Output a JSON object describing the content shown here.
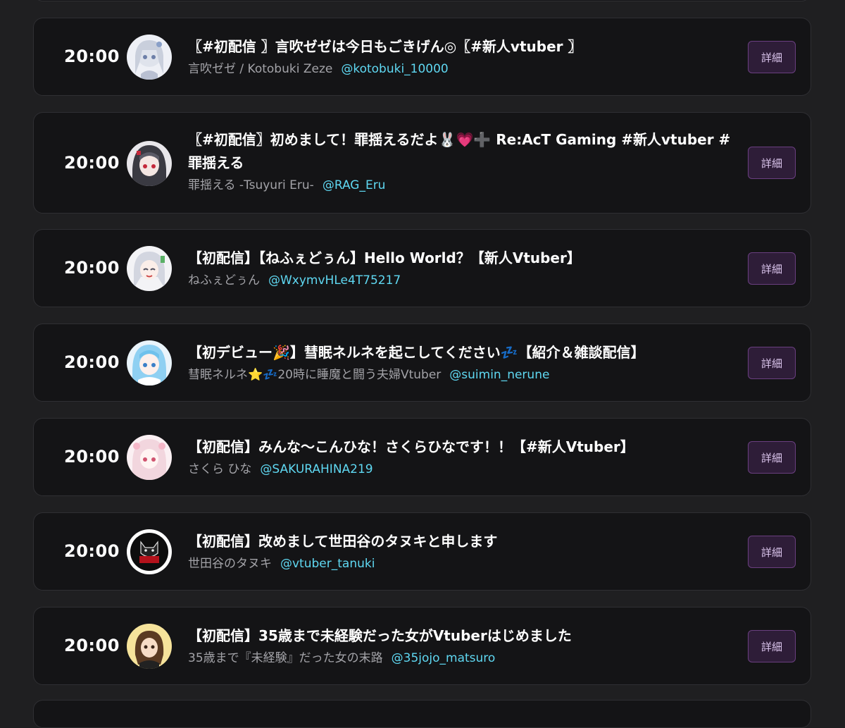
{
  "streams": [
    {
      "time": "20:00",
      "avatar_icon": "avatar-kotobuki-zeze-icon",
      "title": "〖#初配信 〗言吹ゼゼは今日もごきげん◎〖#新人vtuber 〗",
      "channel": "言吹ゼゼ / Kotobuki Zeze",
      "handle": "@kotobuki_10000",
      "detail_label": "詳細"
    },
    {
      "time": "20:00",
      "avatar_icon": "avatar-tsuyuri-eru-icon",
      "title": "〖#初配信〗初めまして！罪揺えるだよ🐰💗➕ Re:AcT Gaming #新人vtuber #罪揺える",
      "channel": "罪揺える -Tsuyuri Eru-",
      "handle": "@RAG_Eru",
      "detail_label": "詳細"
    },
    {
      "time": "20:00",
      "avatar_icon": "avatar-nefuedoxu-icon",
      "title": "【初配信】【ねふぇどぅん】Hello World？【新人Vtuber】",
      "channel": "ねふぇどぅん",
      "handle": "@WxymvHLe4T75217",
      "detail_label": "詳細"
    },
    {
      "time": "20:00",
      "avatar_icon": "avatar-suimin-nerune-icon",
      "title": "【初デビュー🎉】彗眠ネルネを起こしてください💤【紹介＆雑談配信】",
      "channel": "彗眠ネルネ⭐💤20時に睡魔と闘う夫婦Vtuber",
      "handle": "@suimin_nerune",
      "detail_label": "詳細"
    },
    {
      "time": "20:00",
      "avatar_icon": "avatar-sakura-hina-icon",
      "title": "【初配信】みんな〜こんひな！さくらひなです！！【#新人Vtuber】",
      "channel": "さくら ひな",
      "handle": "@SAKURAHINA219",
      "detail_label": "詳細"
    },
    {
      "time": "20:00",
      "avatar_icon": "avatar-setagaya-tanuki-icon",
      "title": "【初配信】改めまして世田谷のタヌキと申します",
      "channel": "世田谷のタヌキ",
      "handle": "@vtuber_tanuki",
      "detail_label": "詳細"
    },
    {
      "time": "20:00",
      "avatar_icon": "avatar-35jojo-matsuro-icon",
      "title": "【初配信】35歳まで未経験だった女がVtuberはじめました",
      "channel": "35歳まで『未経験』だった女の末路",
      "handle": "@35jojo_matsuro",
      "detail_label": "詳細"
    }
  ],
  "colors": {
    "page_bg": "#1f1f21",
    "card_bg": "#141416",
    "handle": "#5fd8f2",
    "button_bg": "#2e1d38",
    "button_border": "#6a3f80"
  }
}
